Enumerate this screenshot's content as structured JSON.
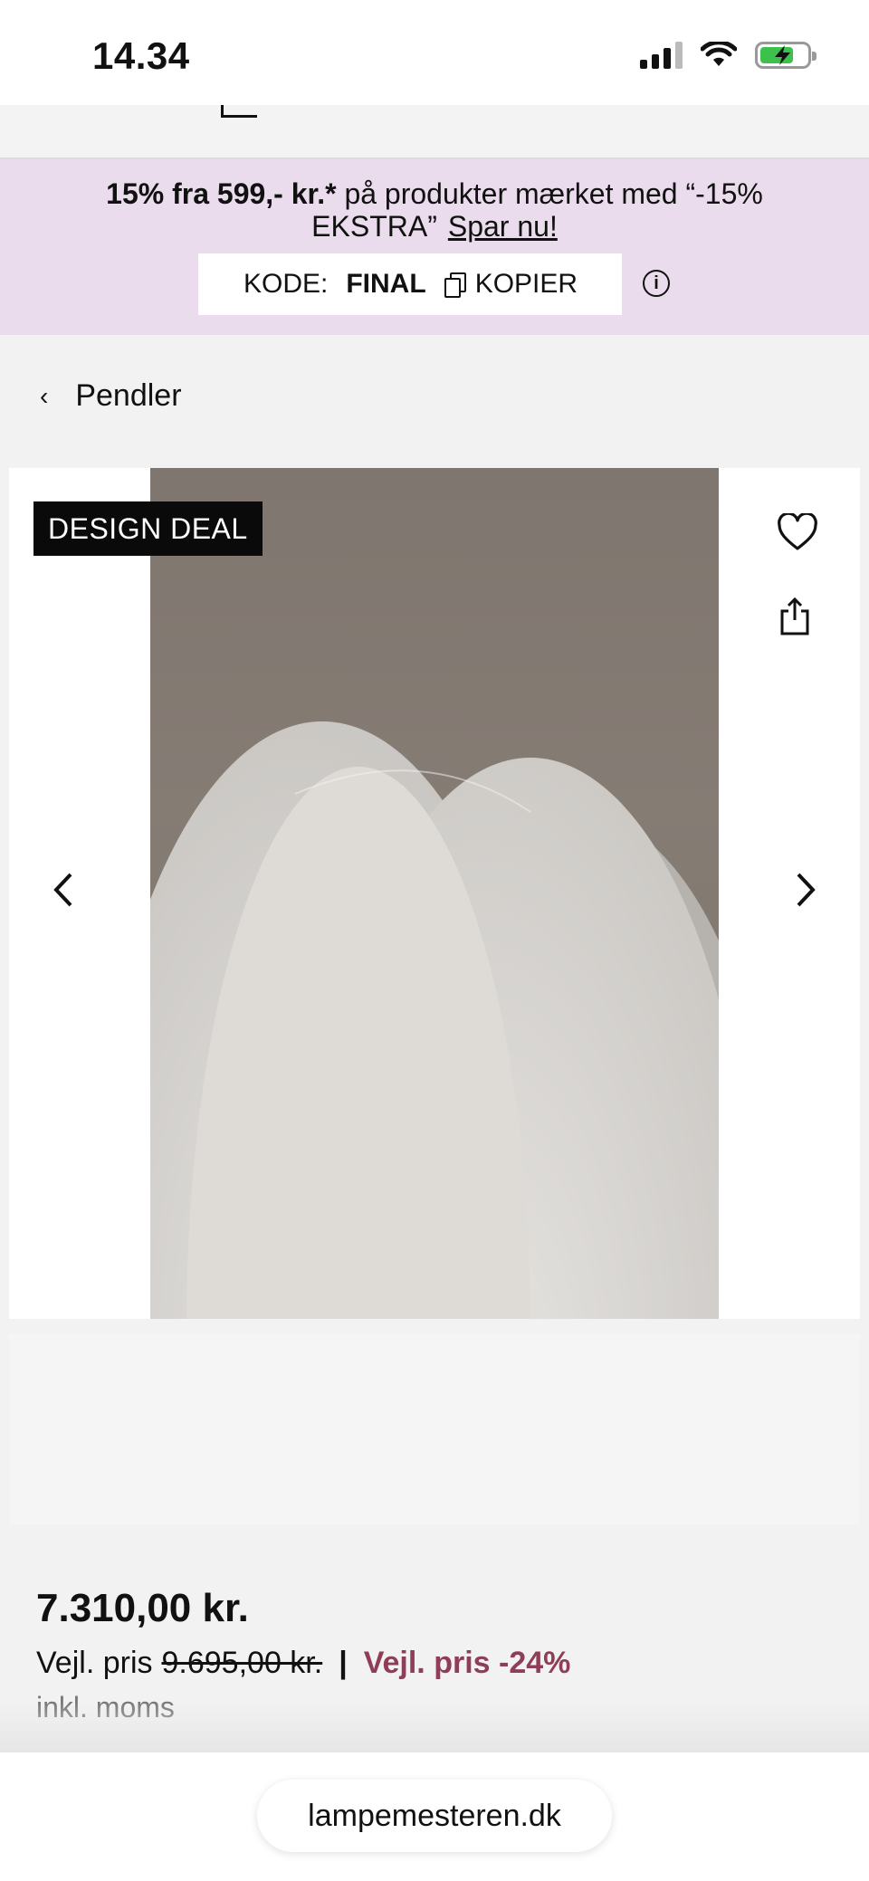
{
  "status_bar": {
    "time": "14.34"
  },
  "promo": {
    "highlight": "15% fra 599,- kr.*",
    "text": " på produkter mærket med “-15% EKSTRA”",
    "link_label": "Spar nu!",
    "code_label": "KODE:",
    "code_value": "FINAL",
    "copy_label": "KOPIER"
  },
  "breadcrumb": {
    "label": "Pendler"
  },
  "gallery": {
    "badge": "DESIGN DEAL",
    "icons": [
      "heart-icon",
      "share-icon",
      "chevron-left-icon",
      "chevron-right-icon"
    ]
  },
  "pricing": {
    "price": "7.310,00 kr.",
    "rrp_label": "Vejl. pris",
    "rrp_value": "9.695,00 kr.",
    "separator": "|",
    "discount": "Vejl. pris -24%",
    "vat_note": "inkl. moms"
  },
  "browser": {
    "url": "lampemesteren.dk"
  },
  "colors": {
    "promo_bg": "#eadcec",
    "discount": "#8e3e56",
    "badge_bg": "#0a0a0a"
  }
}
